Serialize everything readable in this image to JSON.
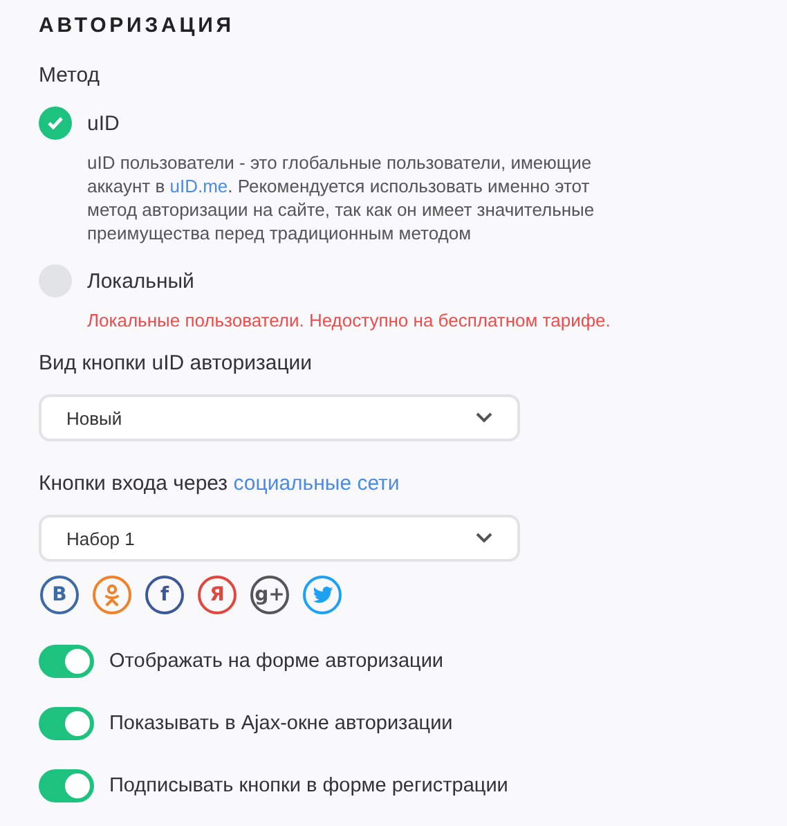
{
  "section_title": "АВТОРИЗАЦИЯ",
  "method": {
    "label": "Метод",
    "options": [
      {
        "label": "uID",
        "selected": true,
        "description": {
          "before": "uID пользователи - это глобальные пользователи, имеющие аккаунт в ",
          "link": "uID.me",
          "after": ". Рекомендуется использовать именно этот метод авторизации на сайте, так как он имеет значительные преимущества перед традиционным методом"
        },
        "kind": "info"
      },
      {
        "label": "Локальный",
        "selected": false,
        "description": {
          "before": "Локальные пользователи. Недоступно на бесплатном тарифе."
        },
        "kind": "warning"
      }
    ]
  },
  "button_style": {
    "label": "Вид кнопки uID авторизации",
    "value": "Новый"
  },
  "social": {
    "label": "Кнопки входа через ",
    "link": "социальные сети",
    "value": "Набор 1",
    "icons": [
      {
        "kind": "letter",
        "text": "В",
        "color": "#3d6aa5"
      },
      {
        "kind": "ok",
        "color": "#f0832a"
      },
      {
        "kind": "letter",
        "text": "f",
        "color": "#3b5998"
      },
      {
        "kind": "letter",
        "text": "Я",
        "color": "#e0483e"
      },
      {
        "kind": "letter",
        "text": "g+",
        "color": "#555555"
      },
      {
        "kind": "bird",
        "color": "#1da1f2"
      }
    ]
  },
  "toggles": [
    {
      "label": "Отображать на форме авторизации",
      "on": true
    },
    {
      "label": "Показывать в Ajax-окне авторизации",
      "on": true
    },
    {
      "label": "Подписывать кнопки в форме регистрации",
      "on": true
    }
  ]
}
